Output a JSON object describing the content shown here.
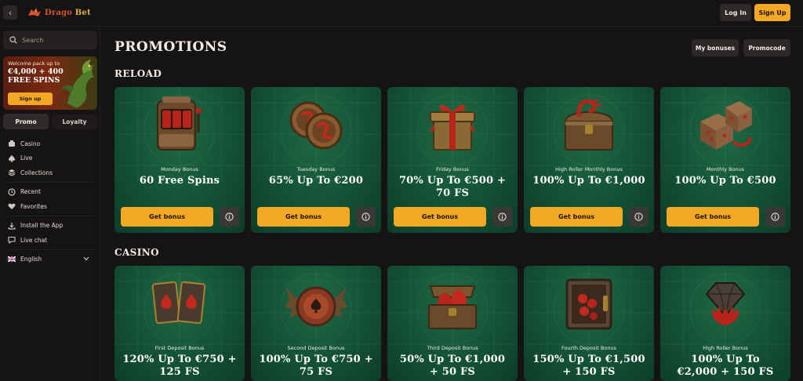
{
  "header": {
    "logo": {
      "part1": "Drago",
      "part2": "Bet"
    },
    "login_label": "Log In",
    "signup_label": "Sign Up"
  },
  "sidebar": {
    "search_placeholder": "Search",
    "banner": {
      "welcome": "Welcome pack up to",
      "amount": "€4,000 + 400 FREE SPINS",
      "button": "Sign up"
    },
    "tabs": [
      {
        "label": "Promo",
        "active": true
      },
      {
        "label": "Loyalty",
        "active": false
      }
    ],
    "nav": {
      "casino": "Casino",
      "live": "Live",
      "collections": "Collections",
      "recent": "Recent",
      "favorites": "Favorites",
      "install": "Install the App",
      "livechat": "Live chat",
      "language": "English"
    }
  },
  "main": {
    "title": "PROMOTIONS",
    "my_bonuses": "My bonuses",
    "promocode": "Promocode",
    "sections": {
      "reload": {
        "title": "RELOAD",
        "cards": [
          {
            "art": "slot-machine-icon",
            "subtitle": "Monday Bonus",
            "line1": "60 Free Spins",
            "line2": "",
            "button": "Get bonus"
          },
          {
            "art": "dragon-coins-icon",
            "subtitle": "Tuesday Bonus",
            "line1": "65% Up To €200",
            "line2": "",
            "button": "Get bonus"
          },
          {
            "art": "gift-box-icon",
            "subtitle": "Friday Bonus",
            "line1": "70% Up To €500 +",
            "line2": "70 FS",
            "button": "Get bonus"
          },
          {
            "art": "treasure-chest-icon",
            "subtitle": "High Roller Monthly Bonus",
            "line1": "100% Up To €1,000",
            "line2": "",
            "button": "Get bonus"
          },
          {
            "art": "dice-icon",
            "subtitle": "Monthly Bonus",
            "line1": "100% Up To €500",
            "line2": "",
            "button": "Get bonus"
          }
        ]
      },
      "casino": {
        "title": "CASINO",
        "cards": [
          {
            "art": "playing-cards-icon",
            "subtitle": "First Deposit Bonus",
            "line1": "120% Up To €750 +",
            "line2": "125 FS"
          },
          {
            "art": "winged-chip-icon",
            "subtitle": "Second Deposit Bonus",
            "line1": "100% Up To €750 +",
            "line2": "75 FS"
          },
          {
            "art": "egg-chest-icon",
            "subtitle": "Third Deposit Bonus",
            "line1": "50% Up To €1,000",
            "line2": "+ 50 FS"
          },
          {
            "art": "safe-icon",
            "subtitle": "Fourth Deposit Bonus",
            "line1": "150% Up To €1,500",
            "line2": "+ 150 FS"
          },
          {
            "art": "diamond-claw-icon",
            "subtitle": "High Roller Bonus",
            "line1": "100% Up To",
            "line2": "€2,000 + 150 FS"
          }
        ]
      }
    }
  },
  "colors": {
    "accent": "#f3a823",
    "background": "#151313",
    "card_green": "#15553a"
  }
}
